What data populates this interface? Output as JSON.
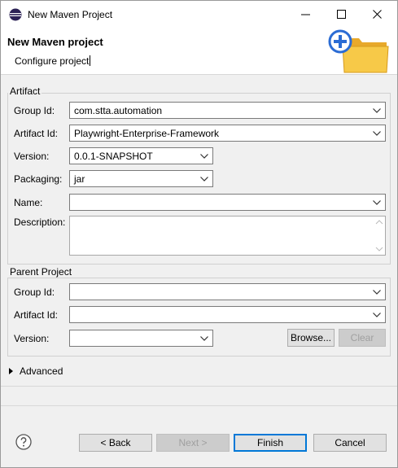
{
  "window": {
    "title": "New Maven Project"
  },
  "banner": {
    "title": "New Maven project",
    "subtitle": "Configure project"
  },
  "artifact": {
    "legend": "Artifact",
    "group_id": {
      "label": "Group Id:",
      "value": "com.stta.automation"
    },
    "artifact_id": {
      "label": "Artifact Id:",
      "value": "Playwright-Enterprise-Framework"
    },
    "version": {
      "label": "Version:",
      "value": "0.0.1-SNAPSHOT"
    },
    "packaging": {
      "label": "Packaging:",
      "value": "jar"
    },
    "name": {
      "label": "Name:",
      "value": ""
    },
    "description": {
      "label": "Description:",
      "value": ""
    }
  },
  "parent": {
    "legend": "Parent Project",
    "group_id": {
      "label": "Group Id:",
      "value": ""
    },
    "artifact_id": {
      "label": "Artifact Id:",
      "value": ""
    },
    "version": {
      "label": "Version:",
      "value": ""
    },
    "browse_label": "Browse...",
    "clear_label": "Clear"
  },
  "advanced": {
    "label": "Advanced"
  },
  "footer": {
    "back_label": "< Back",
    "next_label": "Next >",
    "finish_label": "Finish",
    "cancel_label": "Cancel"
  },
  "icons": {
    "app": "eclipse-icon",
    "banner": "new-folder-icon",
    "help": "help-icon"
  },
  "colors": {
    "accent": "#0078d7",
    "folder": "#f7c948",
    "plus": "#2b6cd4"
  }
}
